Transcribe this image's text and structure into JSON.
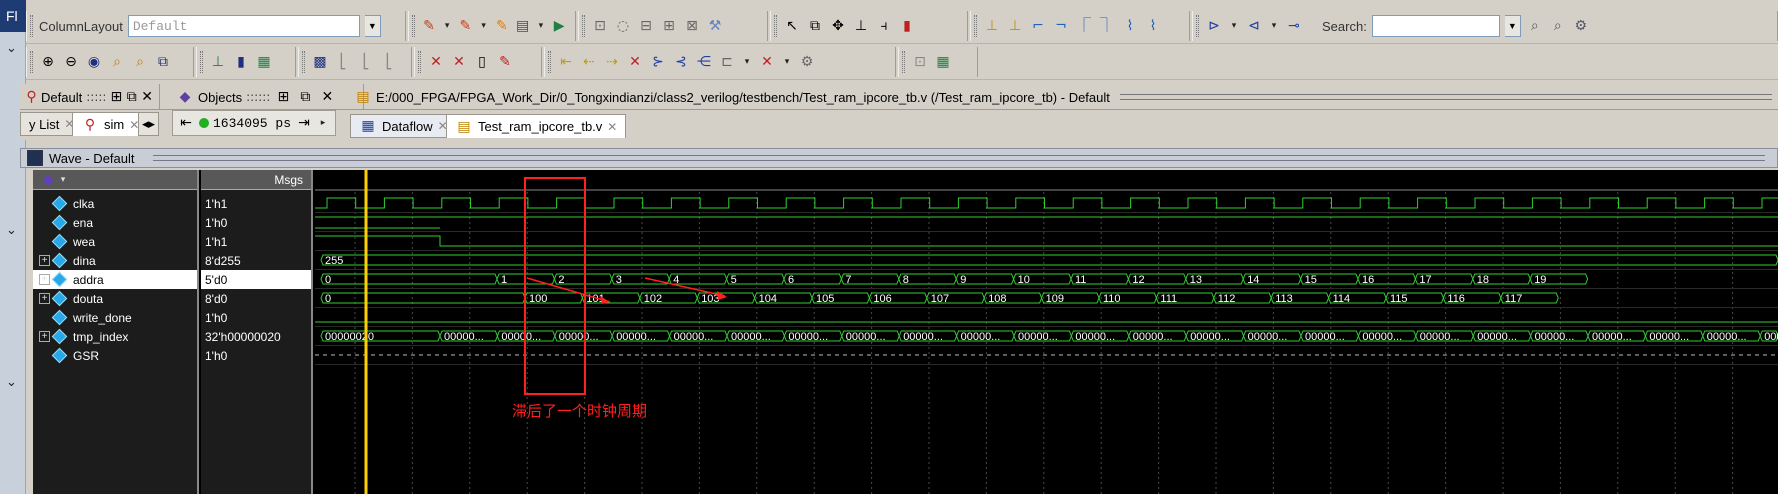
{
  "window": {
    "app_abbr": "Fl"
  },
  "toolbar": {
    "column_layout_label": "ColumnLayout",
    "column_layout_value": "Default",
    "search_label": "Search:",
    "search_value": ""
  },
  "panes": {
    "default_pane": "Default",
    "objects_pane": "Objects",
    "sim_time": "1634095 ps",
    "doc_path": "E:/000_FPGA/FPGA_Work_Dir/0_Tongxindianzi/class2_verilog/testbench/Test_ram_ipcore_tb.v (/Test_ram_ipcore_tb) - Default",
    "tabs_left": [
      "y List",
      "sim"
    ],
    "tabs_doc": [
      "Dataflow",
      "Test_ram_ipcore_tb.v"
    ]
  },
  "wave": {
    "title": "Wave - Default",
    "msgs_header": "Msgs",
    "signals": [
      {
        "name": "clka",
        "value": "1'h1",
        "expand": false
      },
      {
        "name": "ena",
        "value": "1'h0",
        "expand": false
      },
      {
        "name": "wea",
        "value": "1'h1",
        "expand": false
      },
      {
        "name": "dina",
        "value": "8'd255",
        "expand": true
      },
      {
        "name": "addra",
        "value": "5'd0",
        "expand": true,
        "selected": true
      },
      {
        "name": "douta",
        "value": "8'd0",
        "expand": true
      },
      {
        "name": "write_done",
        "value": "1'h0",
        "expand": false
      },
      {
        "name": "tmp_index",
        "value": "32'h00000020",
        "expand": true
      },
      {
        "name": "GSR",
        "value": "1'h0",
        "expand": false
      }
    ],
    "bus_labels": {
      "dina": [
        "255"
      ],
      "addra": [
        "0",
        "1",
        "2",
        "3",
        "4",
        "5",
        "6",
        "7",
        "8",
        "9",
        "10",
        "11",
        "12",
        "13",
        "14",
        "15",
        "16",
        "17",
        "18",
        "19"
      ],
      "douta": [
        "0",
        "100",
        "101",
        "102",
        "103",
        "104",
        "105",
        "106",
        "107",
        "108",
        "109",
        "110",
        "111",
        "112",
        "113",
        "114",
        "115",
        "116",
        "117"
      ],
      "tmp_index_first": "00000020",
      "tmp_index_rest": "00000..."
    },
    "annotation": "滞后了一个时钟周期",
    "colors": {
      "wave": "#30d030",
      "cursor": "#ffd000",
      "annotation": "#ff2020",
      "dashed": "#bbbbbb"
    }
  }
}
